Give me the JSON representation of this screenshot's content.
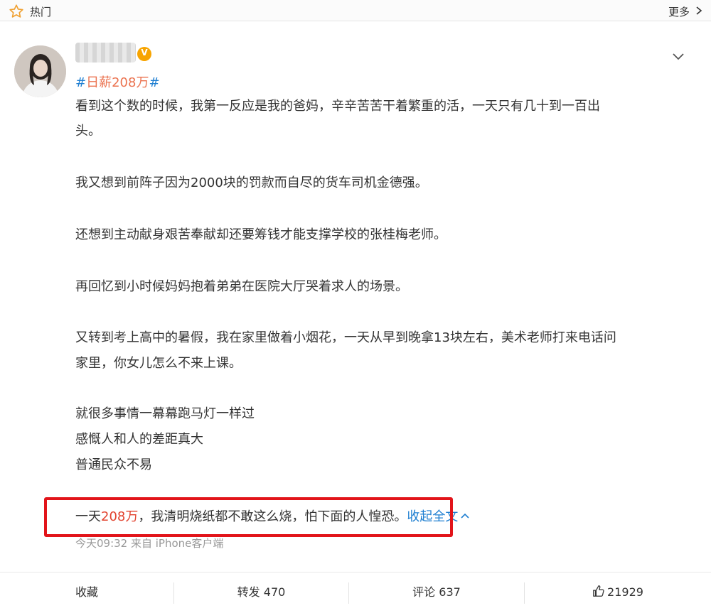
{
  "topbar": {
    "title": "热门",
    "more": "更多"
  },
  "post": {
    "hashtag": {
      "open": "#",
      "text": "日薪208万",
      "close": "#"
    },
    "paragraphs": {
      "p1_l1": "看到这个数的时候，我第一反应是我的爸妈，辛辛苦苦干着繁重的活，一天只有几十到一百出",
      "p1_l2": "头。",
      "p2": "我又想到前阵子因为2000块的罚款而自尽的货车司机金德强。",
      "p3": "还想到主动献身艰苦奉献却还要筹钱才能支撑学校的张桂梅老师。",
      "p4": "再回忆到小时候妈妈抱着弟弟在医院大厅哭着求人的场景。",
      "p5_l1": "又转到考上高中的暑假，我在家里做着小烟花，一天从早到晚拿13块左右，美术老师打来电话问",
      "p5_l2": "家里，你女儿怎么不来上课。",
      "p6_l1": "就很多事情一幕幕跑马灯一样过",
      "p6_l2": "感慨人和人的差距真大",
      "p6_l3": "普通民众不易"
    },
    "last_line": {
      "prefix": "一天",
      "amount": "208万",
      "suffix": "，我清明烧纸都不敢这么烧，怕下面的人惶恐。",
      "collapse": "收起全文"
    },
    "meta": "今天09:32  来自 iPhone客户端"
  },
  "actions": {
    "favorite": "收藏",
    "repost": "转发 470",
    "comment": "评论 637",
    "like": "21929"
  },
  "colors": {
    "hashtag_text": "#eb7350",
    "link": "#1f7fd1",
    "highlight_box": "#e2141a",
    "vip_badge": "#f7a400"
  }
}
